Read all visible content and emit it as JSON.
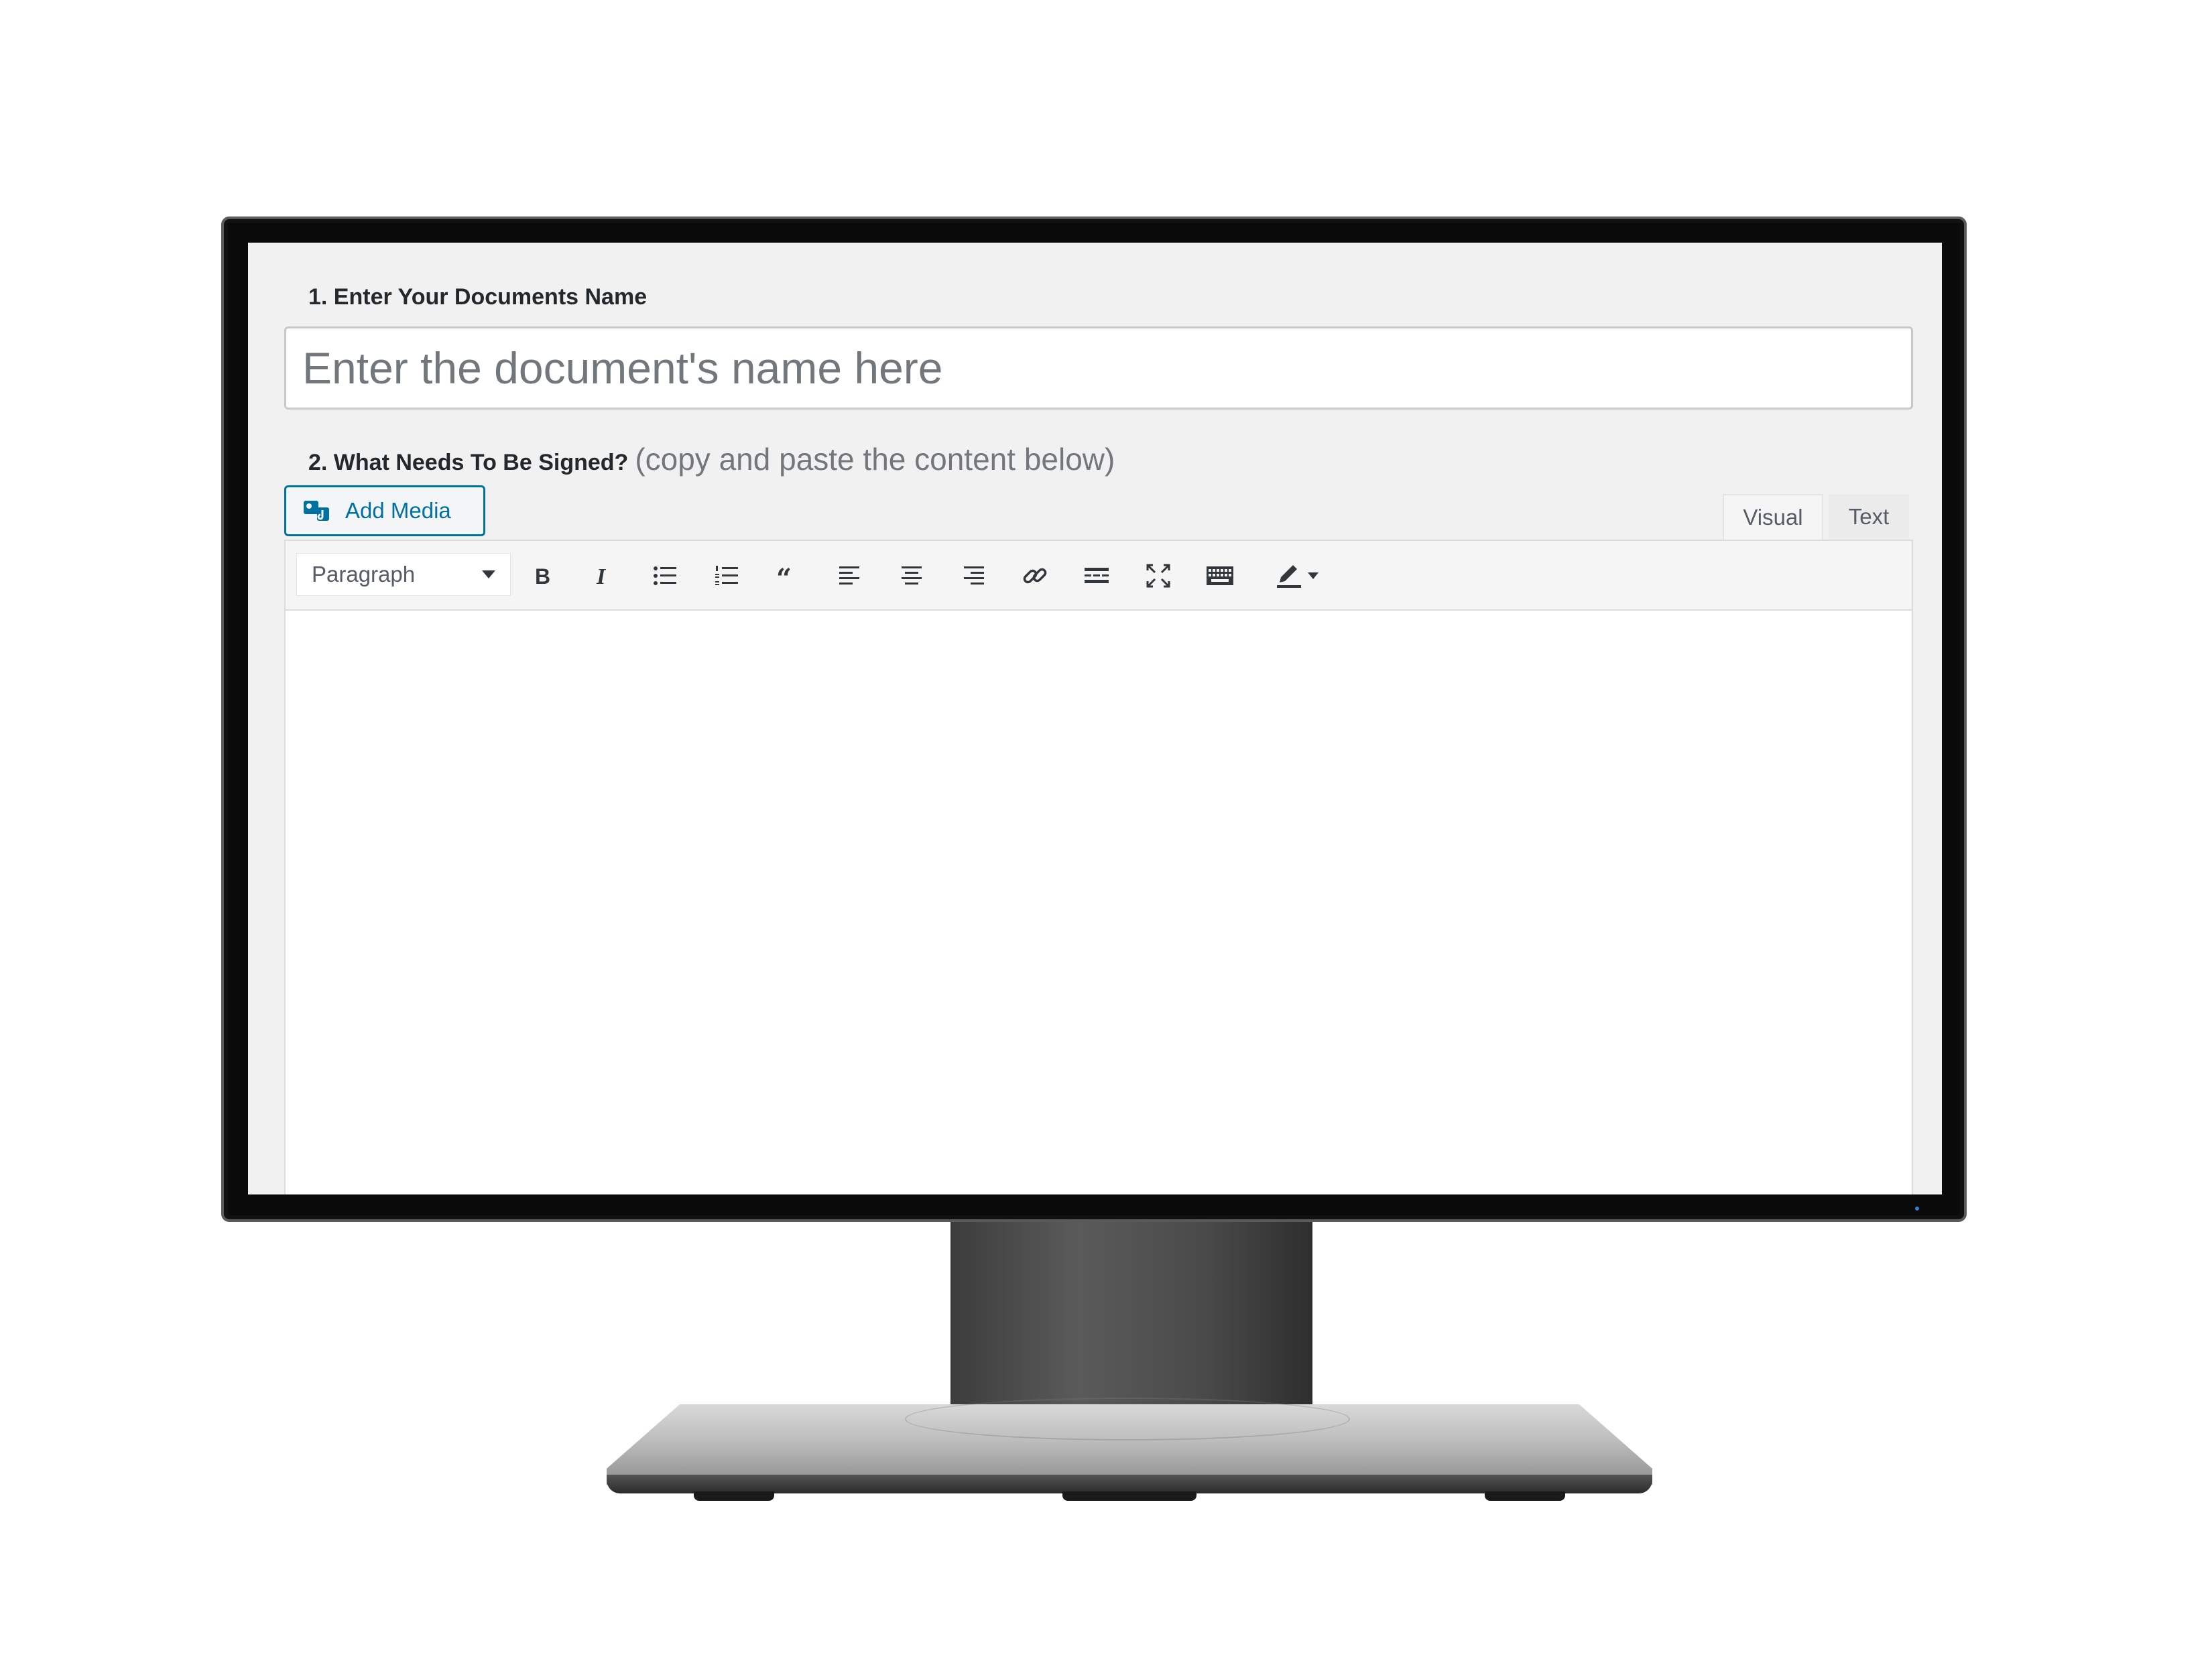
{
  "form": {
    "step1_label": "1. Enter Your Documents Name",
    "name_placeholder": "Enter the document's name here",
    "name_value": "",
    "step2_label": "2. What Needs To Be Signed?",
    "step2_hint": "(copy and paste the content below)"
  },
  "editor": {
    "add_media_label": "Add Media",
    "tabs": {
      "visual": "Visual",
      "text": "Text"
    },
    "active_tab": "Visual",
    "format_select": "Paragraph",
    "toolbar_icons": [
      "bold-icon",
      "italic-icon",
      "bulleted-list-icon",
      "numbered-list-icon",
      "blockquote-icon",
      "align-left-icon",
      "align-center-icon",
      "align-right-icon",
      "link-icon",
      "read-more-icon",
      "fullscreen-icon",
      "keyboard-icon",
      "text-color-icon"
    ],
    "content": ""
  },
  "colors": {
    "accent": "#0071a1",
    "text": "#23282d",
    "muted": "#72777c",
    "toolbar_bg": "#f5f5f5"
  }
}
